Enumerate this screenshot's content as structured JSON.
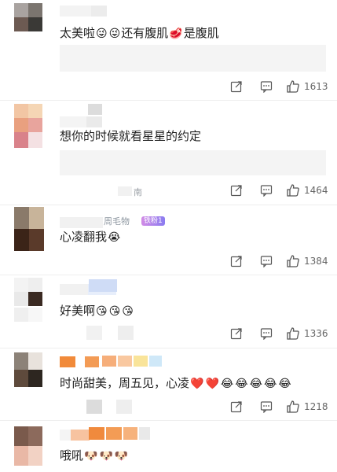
{
  "comments": [
    {
      "text_parts": [
        "太美啦",
        "😜",
        "😜",
        "还有腹肌",
        "🥩",
        "是腹肌"
      ],
      "like_count": "1613"
    },
    {
      "text_parts": [
        "想你的时候就看星星的约定"
      ],
      "location_fragment": "南",
      "like_count": "1464"
    },
    {
      "name_fragment": "周毛物",
      "badge": "铁粉1",
      "text_parts": [
        "心凌翻我",
        "😭"
      ],
      "like_count": "1384"
    },
    {
      "text_parts": [
        "好美啊",
        "😘",
        "😘",
        "😘"
      ],
      "like_count": "1336"
    },
    {
      "text_parts": [
        "时尚甜美，周五见，心凌",
        "❤️",
        "❤️",
        "😂",
        "😂",
        "😂",
        "😂",
        "😂"
      ],
      "like_count": "1218"
    },
    {
      "text_parts": [
        "哦吼",
        "🐶",
        "🐶",
        "🐶"
      ]
    }
  ],
  "colors": {
    "like_blue": "#1e88e5",
    "heart_red": "#e53935",
    "emoji_yellow": "#f6c23e"
  },
  "icons": [
    "share-icon",
    "comment-icon",
    "like-icon"
  ]
}
